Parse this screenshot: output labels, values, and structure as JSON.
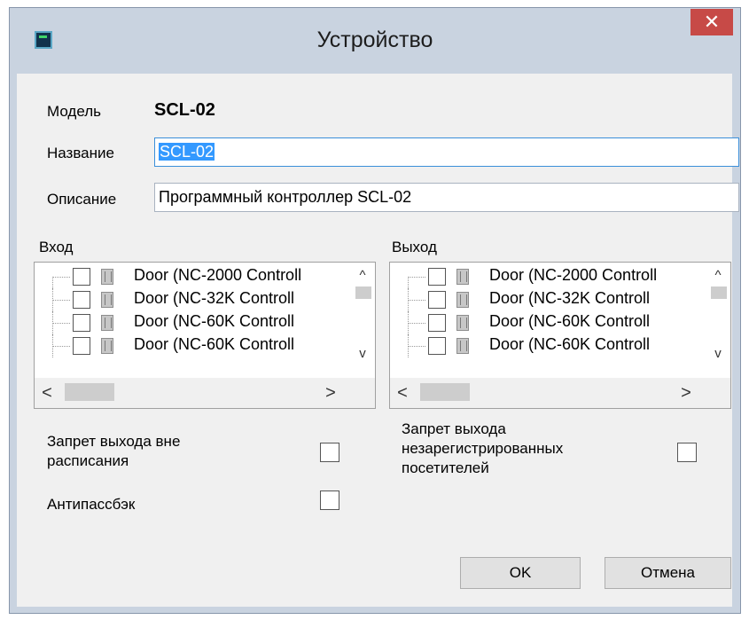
{
  "dialog": {
    "title": "Устройство",
    "close_glyph": "✕"
  },
  "model": {
    "label": "Модель",
    "value": "SCL-02"
  },
  "name": {
    "label": "Название",
    "value": "SCL-02"
  },
  "description": {
    "label": "Описание",
    "value": "Программный контроллер SCL-02"
  },
  "input": {
    "label": "Вход",
    "items": [
      "Door (NC-2000 Controll",
      "Door (NC-32K Controll",
      "Door (NC-60K Controll",
      "Door (NC-60K Controll"
    ]
  },
  "output": {
    "label": "Выход",
    "items": [
      "Door (NC-2000 Controll",
      "Door (NC-32K Controll",
      "Door (NC-60K Controll",
      "Door (NC-60K Controll"
    ]
  },
  "options": {
    "deny_exit_outside_schedule": {
      "line1": "Запрет выхода вне",
      "line2": "расписания"
    },
    "antipassback": "Антипассбэк",
    "deny_exit_unregistered": {
      "line1": "Запрет выхода",
      "line2": "незарегистрированных",
      "line3": "посетителей"
    }
  },
  "buttons": {
    "ok": "OK",
    "cancel": "Отмена"
  },
  "scroll": {
    "up": "^",
    "down": "v",
    "left": "<",
    "right": ">"
  },
  "colors": {
    "close": "#c74a47",
    "selection": "#3399ff",
    "titlebar": "#c9d3e0"
  }
}
